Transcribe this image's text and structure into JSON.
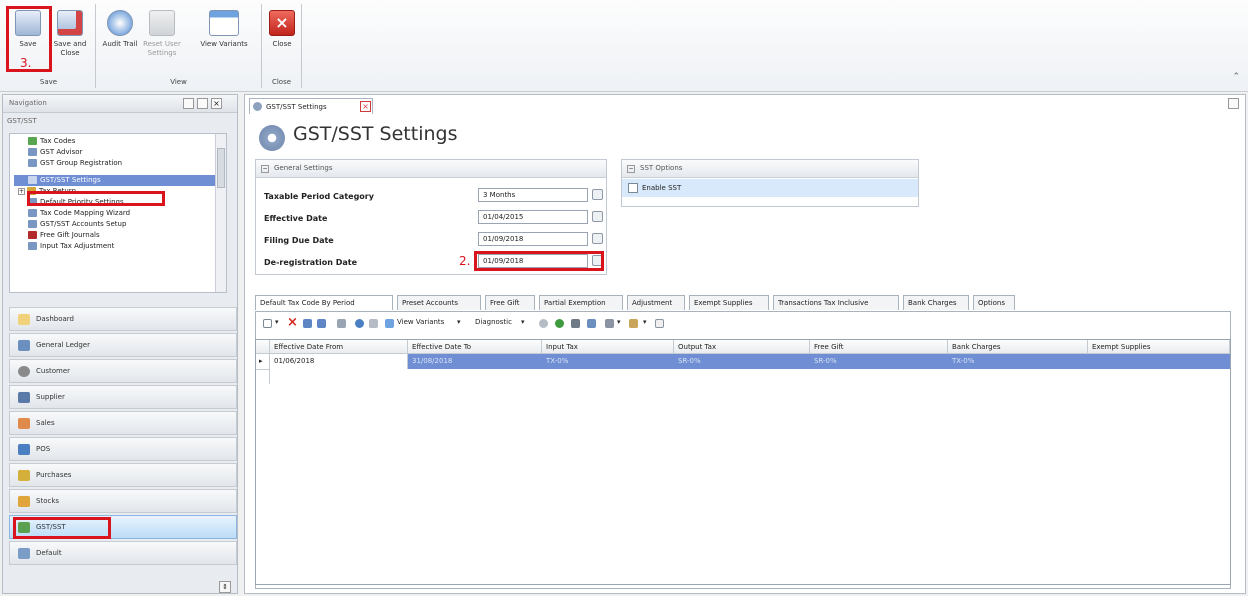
{
  "ribbon": {
    "groups": [
      {
        "label": "Save"
      },
      {
        "label": "View"
      },
      {
        "label": "Close"
      }
    ],
    "buttons": {
      "save": "Save",
      "save_close": "Save and Close",
      "audit_trail": "Audit Trail",
      "reset_user_settings": "Reset User Settings",
      "view_variants": "View Variants",
      "close": "Close"
    },
    "step3": "3."
  },
  "navigation": {
    "title": "Navigation",
    "section": "GST/SST",
    "tree": [
      {
        "label": "Tax Codes"
      },
      {
        "label": "GST Advisor"
      },
      {
        "label": "GST Group Registration"
      },
      {
        "label": "GST/SST Settings"
      },
      {
        "label": "Tax Return"
      },
      {
        "label": "Default Priority Settings"
      },
      {
        "label": "Tax Code Mapping Wizard"
      },
      {
        "label": "GST/SST Accounts Setup"
      },
      {
        "label": "Free Gift Journals"
      },
      {
        "label": "Input Tax Adjustment"
      }
    ],
    "modules": [
      {
        "label": "Dashboard"
      },
      {
        "label": "General Ledger"
      },
      {
        "label": "Customer"
      },
      {
        "label": "Supplier"
      },
      {
        "label": "Sales"
      },
      {
        "label": "POS"
      },
      {
        "label": "Purchases"
      },
      {
        "label": "Stocks"
      },
      {
        "label": "GST/SST"
      },
      {
        "label": "Default"
      }
    ]
  },
  "document": {
    "tab": "GST/SST Settings",
    "title": "GST/SST Settings",
    "general": {
      "header": "General Settings",
      "fields": [
        {
          "label": "Taxable Period Category",
          "value": "3 Months"
        },
        {
          "label": "Effective Date",
          "value": "01/04/2015"
        },
        {
          "label": "Filing Due Date",
          "value": "01/09/2018"
        },
        {
          "label": "De-registration Date",
          "value": "01/09/2018"
        }
      ],
      "step2": "2."
    },
    "sst": {
      "header": "SST Options",
      "enable": "Enable SST"
    },
    "tabs": [
      {
        "label": "Default Tax Code By Period"
      },
      {
        "label": "Preset Accounts"
      },
      {
        "label": "Free Gift"
      },
      {
        "label": "Partial Exemption"
      },
      {
        "label": "Adjustment"
      },
      {
        "label": "Exempt Supplies"
      },
      {
        "label": "Transactions Tax Inclusive"
      },
      {
        "label": "Bank Charges"
      },
      {
        "label": "Options"
      }
    ],
    "toolbar": {
      "view_variants": "View Variants",
      "diagnostic": "Diagnostic"
    },
    "grid": {
      "columns": [
        {
          "label": "Effective Date From"
        },
        {
          "label": "Effective Date To"
        },
        {
          "label": "Input Tax"
        },
        {
          "label": "Output Tax"
        },
        {
          "label": "Free Gift"
        },
        {
          "label": "Bank Charges"
        },
        {
          "label": "Exempt Supplies"
        }
      ],
      "rows": [
        {
          "cells": [
            {
              "value": "01/06/2018"
            },
            {
              "value": "31/08/2018"
            },
            {
              "value": "TX-0%"
            },
            {
              "value": "SR-0%"
            },
            {
              "value": "SR-0%"
            },
            {
              "value": "TX-0%"
            },
            {
              "value": ""
            }
          ]
        }
      ]
    }
  }
}
